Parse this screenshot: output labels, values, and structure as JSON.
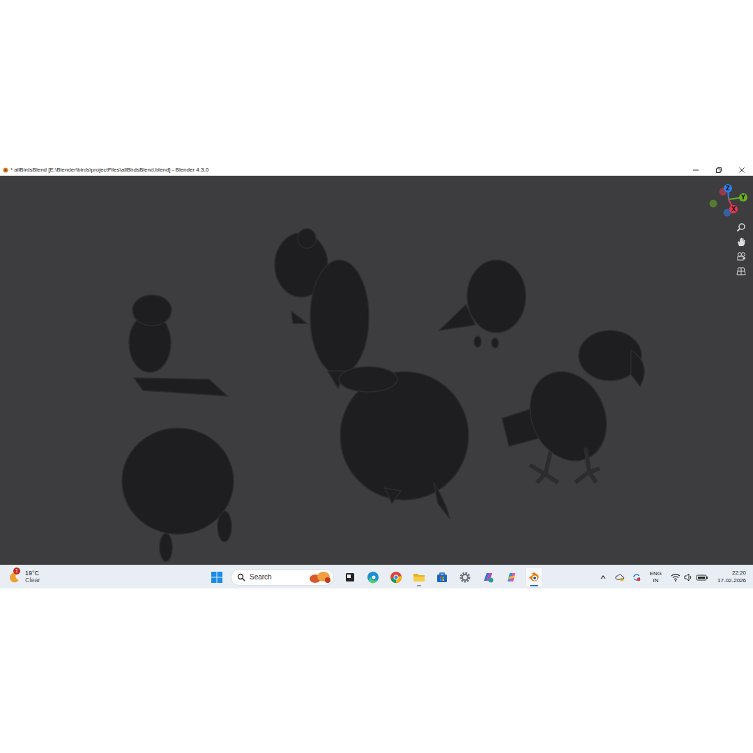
{
  "window": {
    "title": "* allBirdsBlend [E:\\Blender\\birds\\projectFiles\\allBirdsBlend.blend] - Blender 4.3.0"
  },
  "gizmo": {
    "axes": [
      {
        "label": "Z",
        "color": "#2f80ed"
      },
      {
        "label": "Y",
        "color": "#6ab023"
      },
      {
        "label": "X",
        "color": "#e8364f"
      }
    ]
  },
  "taskbar": {
    "weather": {
      "badge": "1",
      "temp": "19°C",
      "condition": "Clear"
    },
    "search": {
      "placeholder": "Search"
    },
    "apps": [
      {
        "kind": "taskview",
        "open": false,
        "selected": false
      },
      {
        "kind": "edge",
        "open": false,
        "selected": false
      },
      {
        "kind": "chrome",
        "open": false,
        "selected": false
      },
      {
        "kind": "explorer",
        "open": true,
        "selected": false
      },
      {
        "kind": "store",
        "open": false,
        "selected": false
      },
      {
        "kind": "settings",
        "open": false,
        "selected": false
      },
      {
        "kind": "office",
        "open": false,
        "selected": false
      },
      {
        "kind": "copilot",
        "open": false,
        "selected": false
      },
      {
        "kind": "blender",
        "open": true,
        "selected": true
      }
    ],
    "tray": {
      "language": "ENG",
      "region": "IN",
      "time": "22:20",
      "date": "17-02-2026"
    }
  }
}
